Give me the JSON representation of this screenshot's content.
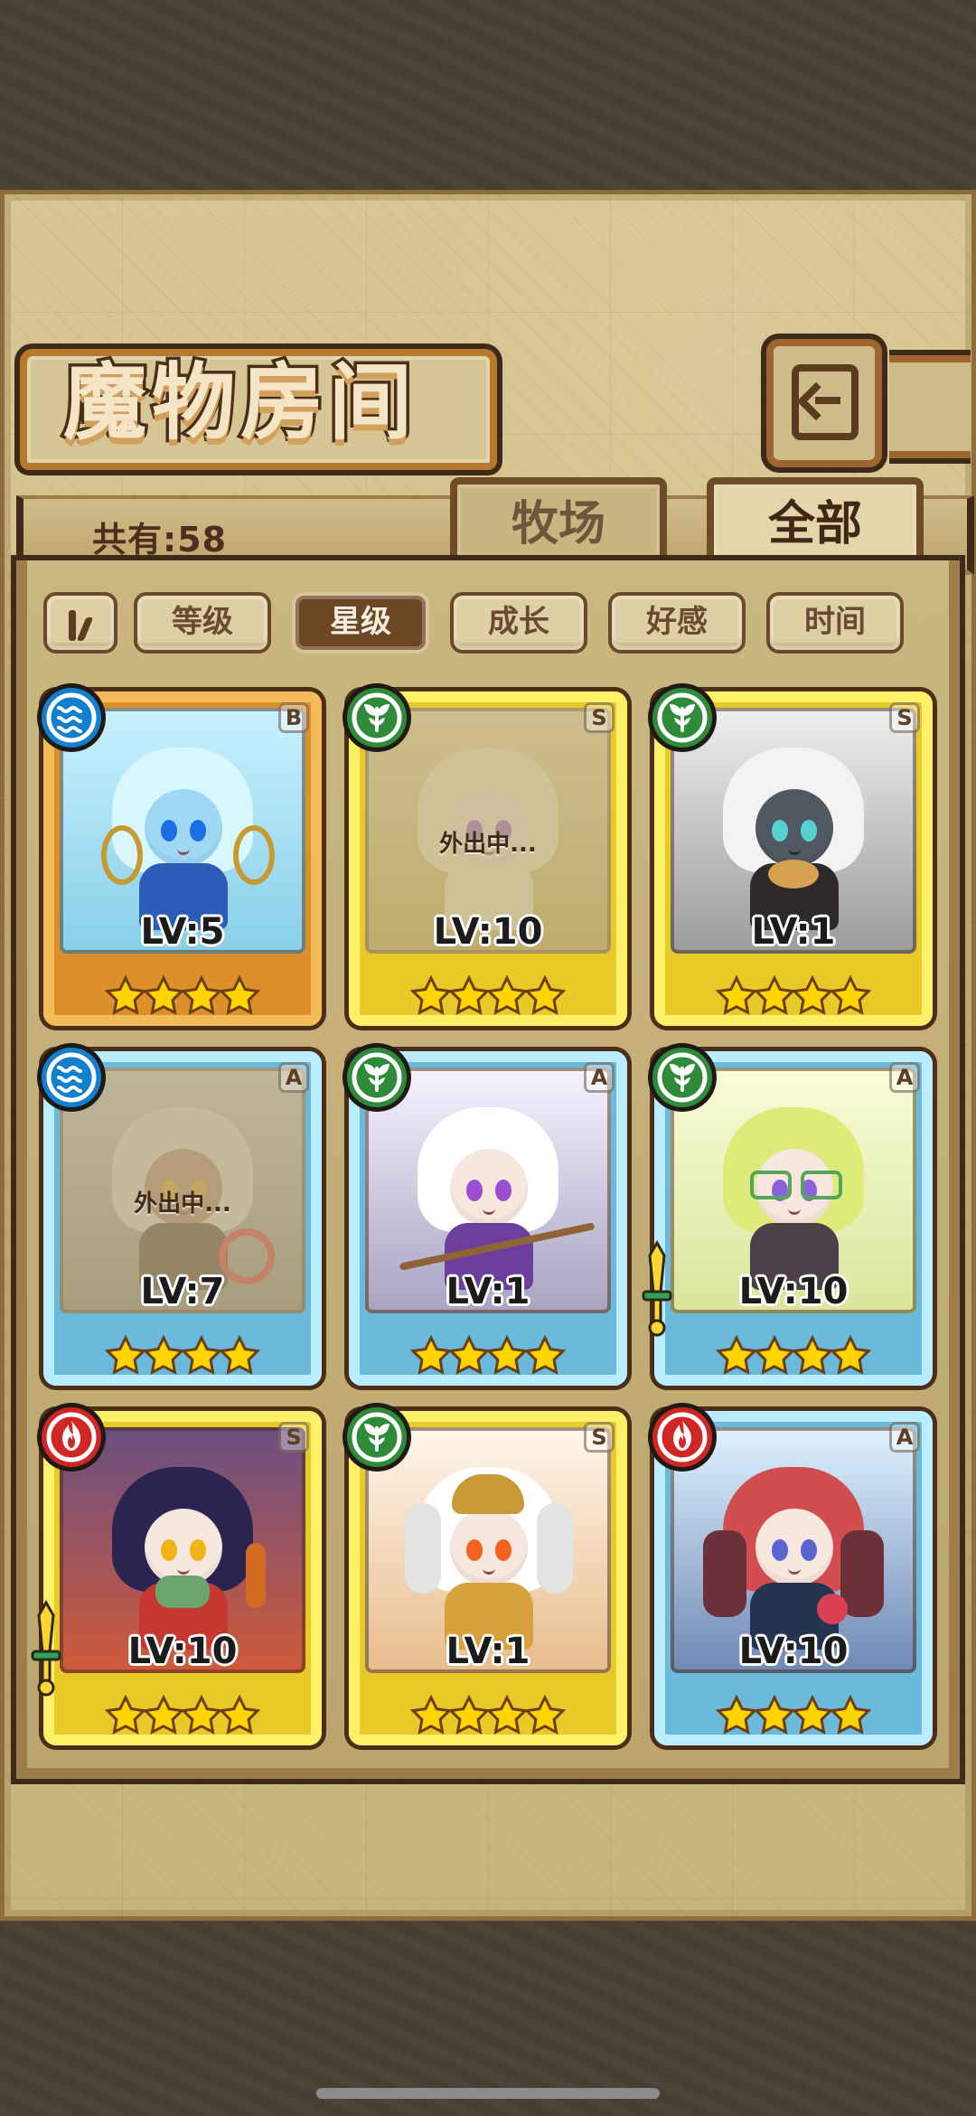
{
  "header": {
    "title": "魔物房间"
  },
  "summary": {
    "count_text": "共有:58"
  },
  "tabs": {
    "ranch": "牧场",
    "all": "全部"
  },
  "filters": {
    "level": "等级",
    "stars": "星级",
    "growth": "成长",
    "affection": "好感",
    "time": "时间"
  },
  "cards": [
    {
      "rank": "B",
      "level": "LV:5",
      "status": "",
      "element": "water",
      "frame": "orange",
      "stars": 4
    },
    {
      "rank": "S",
      "level": "LV:10",
      "status": "外出中...",
      "element": "nature",
      "frame": "yellow",
      "stars": 4
    },
    {
      "rank": "S",
      "level": "LV:1",
      "status": "",
      "element": "nature",
      "frame": "yellow",
      "stars": 4
    },
    {
      "rank": "A",
      "level": "LV:7",
      "status": "外出中...",
      "element": "water",
      "frame": "blue",
      "stars": 4
    },
    {
      "rank": "A",
      "level": "LV:1",
      "status": "",
      "element": "nature",
      "frame": "blue",
      "stars": 4
    },
    {
      "rank": "A",
      "level": "LV:10",
      "status": "",
      "element": "nature",
      "frame": "blue",
      "stars": 4,
      "marker": "sword"
    },
    {
      "rank": "S",
      "level": "LV:10",
      "status": "",
      "element": "fire",
      "frame": "yellow",
      "stars": 4,
      "marker": "sword"
    },
    {
      "rank": "S",
      "level": "LV:1",
      "status": "",
      "element": "nature",
      "frame": "yellow",
      "stars": 4
    },
    {
      "rank": "A",
      "level": "LV:10",
      "status": "",
      "element": "fire",
      "frame": "blue",
      "stars": 4
    }
  ]
}
